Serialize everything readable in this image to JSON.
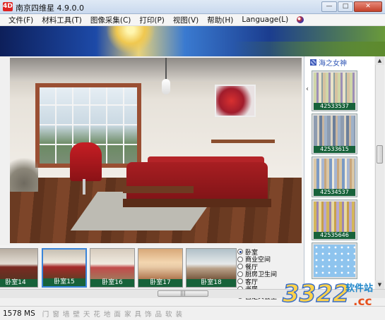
{
  "window": {
    "title": "南京四维星 4.9.0.0",
    "app_icon": "4D",
    "minimize": "—",
    "maximize": "□",
    "close": "✕"
  },
  "menu": {
    "items": [
      "文件(F)",
      "材料工具(T)",
      "图像采集(C)",
      "打印(P)",
      "视图(V)",
      "帮助(H)",
      "Language(L)"
    ]
  },
  "materials": {
    "header": "海之女神",
    "swatches": [
      {
        "code": "42533537"
      },
      {
        "code": "42533615"
      },
      {
        "code": "42534537"
      },
      {
        "code": "42535646"
      },
      {
        "code": ""
      }
    ],
    "panel_arrow": "‹"
  },
  "thumbnails": [
    {
      "label": "卧室14"
    },
    {
      "label": "卧室15"
    },
    {
      "label": "卧室16"
    },
    {
      "label": "卧室17"
    },
    {
      "label": "卧室18"
    }
  ],
  "categories": [
    "卧室",
    "商业空间",
    "餐厅",
    "厨房卫生间",
    "客厅",
    "书房",
    "自定义套型"
  ],
  "selected_category": "卧室",
  "status": {
    "text": "1578 MS",
    "links": "门 窗 墙 壁 天 花 地 面 家 具 饰 品 软 装"
  },
  "watermark": {
    "mark": "3322",
    "site": "软件站",
    "domain": ".cc"
  },
  "colors": {
    "thumb_label_bg": "#17623a",
    "selection": "#3a84d8",
    "panel_header": "#2e55b5"
  }
}
